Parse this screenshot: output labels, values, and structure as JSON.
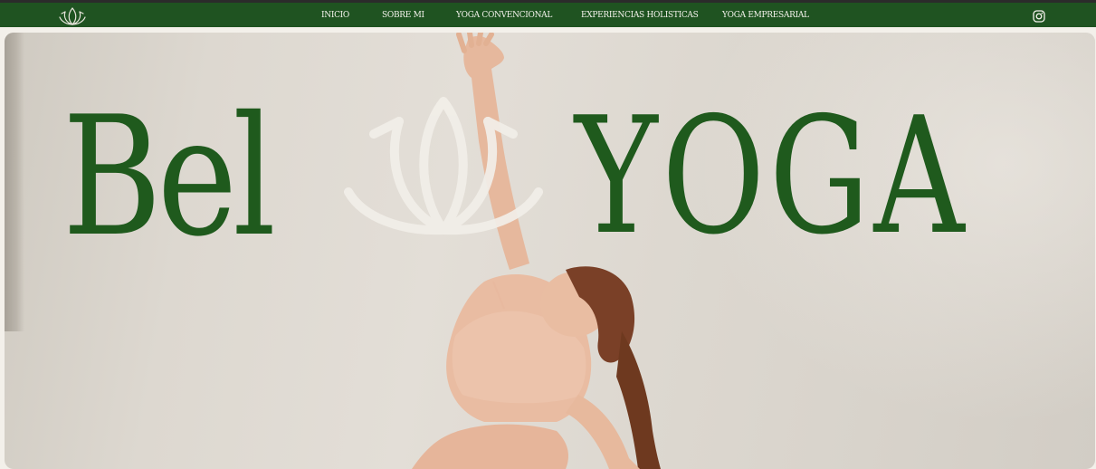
{
  "header": {
    "logo_icon": "lotus-icon",
    "nav": [
      {
        "label": "INICIO"
      },
      {
        "label": "SOBRE MI"
      },
      {
        "label": "YOGA CONVENCIONAL"
      },
      {
        "label": "EXPERIENCIAS HOLISTICAS"
      },
      {
        "label": "YOGA EMPRESARIAL"
      }
    ],
    "social_icon": "instagram-icon"
  },
  "hero": {
    "title_left": "Bel",
    "title_right": "YOGA",
    "emblem_icon": "lotus-icon",
    "image": "woman-yoga-pose-photo"
  },
  "colors": {
    "brand_green": "#1f5321",
    "title_green": "#1f5a1d",
    "nav_text": "#f4f2ec"
  }
}
